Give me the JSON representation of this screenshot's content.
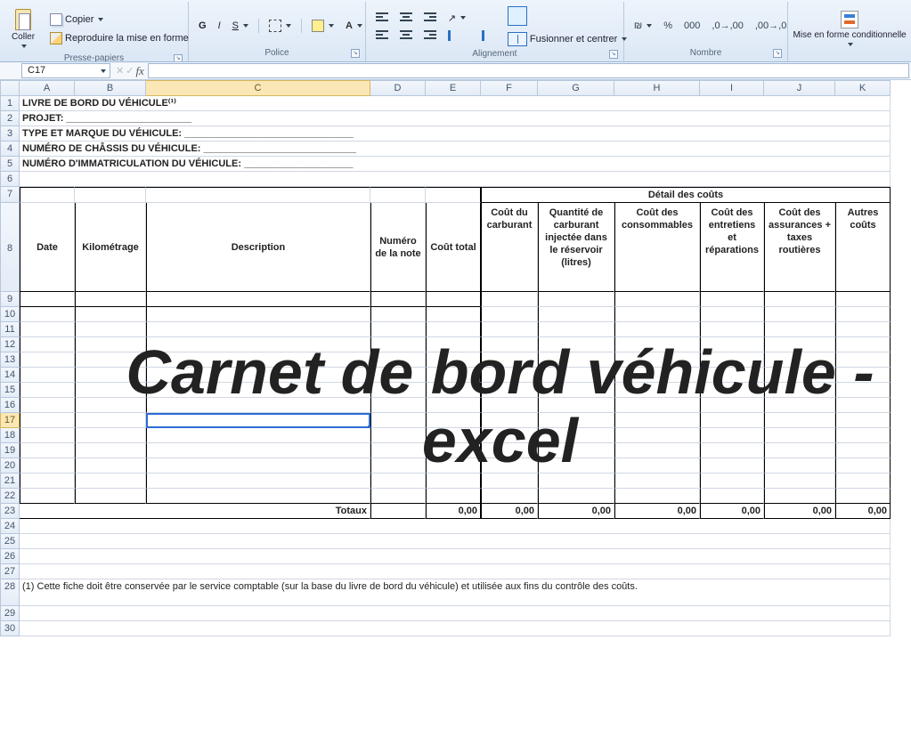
{
  "ribbon": {
    "clipboard": {
      "paste": "Coller",
      "copy": "Copier",
      "format_painter": "Reproduire la mise en forme",
      "title": "Presse-papiers"
    },
    "font": {
      "bold": "G",
      "italic": "I",
      "underline": "S",
      "title": "Police"
    },
    "alignment": {
      "merge_center": "Fusionner et centrer",
      "title": "Alignement"
    },
    "number": {
      "percent": "%",
      "thousands": "000",
      "title": "Nombre"
    },
    "styles": {
      "conditional": "Mise en forme conditionnelle"
    }
  },
  "namebox": "C17",
  "formula": "",
  "columns": [
    "",
    "A",
    "B",
    "C",
    "D",
    "E",
    "F",
    "G",
    "H",
    "I",
    "J",
    "K"
  ],
  "rows": [
    "1",
    "2",
    "3",
    "4",
    "5",
    "6",
    "7",
    "8",
    "9",
    "10",
    "11",
    "12",
    "13",
    "14",
    "15",
    "16",
    "17",
    "18",
    "19",
    "20",
    "21",
    "22",
    "23",
    "24",
    "25",
    "26",
    "27",
    "28",
    "29",
    "30"
  ],
  "selected_cell": {
    "col": "C",
    "row": "17"
  },
  "sheet": {
    "r1": "LIVRE DE BORD DU VÉHICULE⁽¹⁾",
    "r2": "PROJET: _______________________",
    "r3": "TYPE ET MARQUE DU VÉHICULE: _______________________________",
    "r4": "NUMÉRO DE CHÂSSIS DU VÉHICULE: ____________________________",
    "r5": "NUMÉRO D'IMMATRICULATION DU VÉHICULE: ____________________",
    "r7_detail": "Détail des coûts",
    "head": {
      "date": "Date",
      "km": "Kilométrage",
      "desc": "Description",
      "note": "Numéro de la note",
      "total": "Coût total",
      "fuel_cost": "Coût du carburant",
      "fuel_qty": "Quantité de carburant injectée dans le réservoir (litres)",
      "consum": "Coût des consommables",
      "maint": "Coût des entretiens et réparations",
      "insur": "Coût des assurances + taxes routières",
      "other": "Autres coûts"
    },
    "totaux_label": "Totaux",
    "totaux": [
      "0,00",
      "0,00",
      "0,00",
      "0,00",
      "0,00",
      "0,00",
      "0,00"
    ],
    "footnote": "(1) Cette fiche doit être conservée par le service comptable (sur la base du livre de bord du véhicule) et utilisée aux fins du contrôle des coûts."
  },
  "overlay": "Carnet de bord véhicule - excel"
}
